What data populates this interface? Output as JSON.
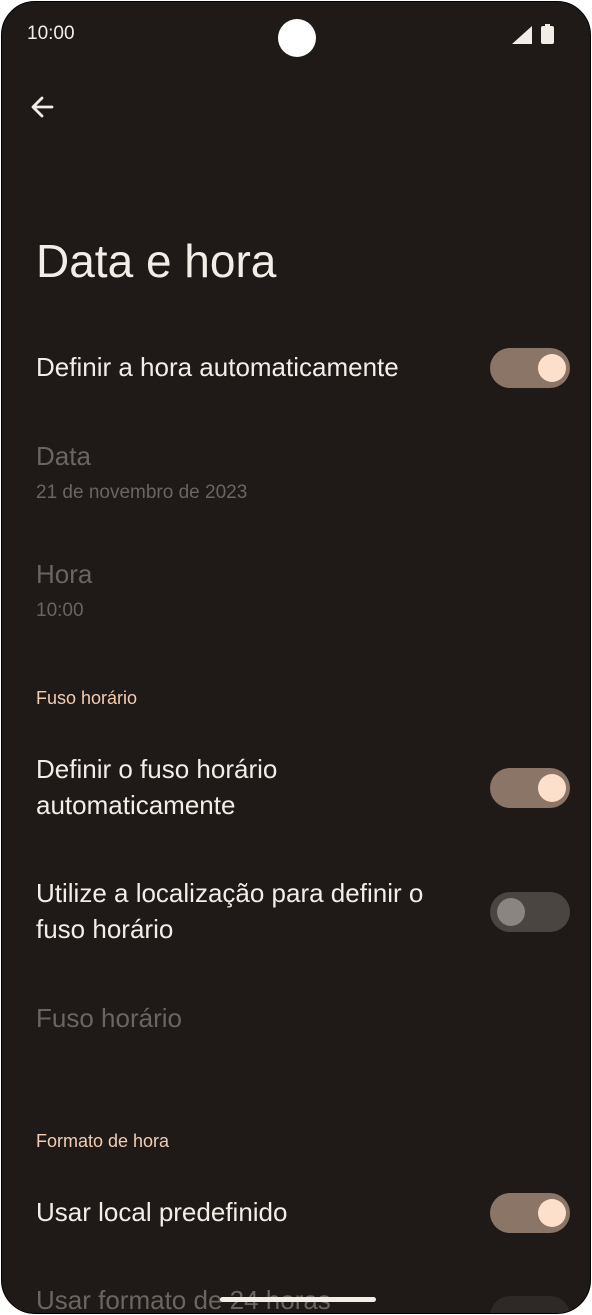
{
  "status_bar": {
    "time": "10:00"
  },
  "header": {
    "title": "Data e hora"
  },
  "settings": {
    "auto_time": {
      "label": "Definir a hora automaticamente",
      "enabled": true
    },
    "date": {
      "label": "Data",
      "value": "21 de novembro de 2023"
    },
    "time": {
      "label": "Hora",
      "value": "10:00"
    },
    "timezone_section": "Fuso horário",
    "auto_timezone": {
      "label": "Definir o fuso horário automaticamente",
      "enabled": true
    },
    "location_timezone": {
      "label": "Utilize a localização para definir o fuso horário",
      "enabled": false
    },
    "timezone": {
      "label": "Fuso horário"
    },
    "format_section": "Formato de hora",
    "locale_default": {
      "label": "Usar local predefinido",
      "enabled": true
    },
    "format_24h": {
      "label": "Usar formato de 24 horas"
    }
  },
  "colors": {
    "background": "#1f1a17",
    "accent": "#f2cdb3",
    "toggle_on": "#8b7566",
    "knob_on": "#fde0cb"
  }
}
